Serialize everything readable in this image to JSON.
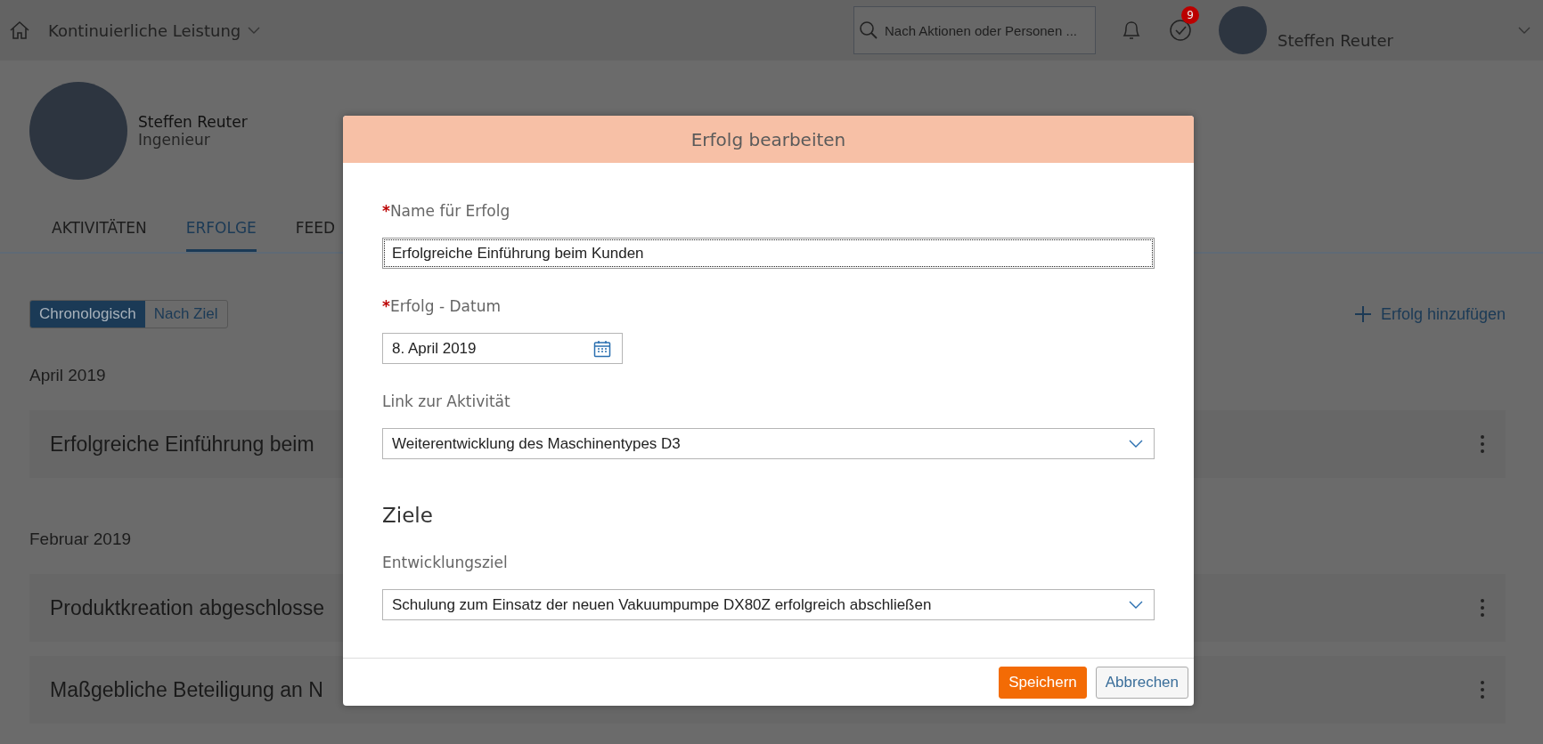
{
  "shell": {
    "title": "Kontinuierliche Leistung",
    "search": {
      "placeholder": "Nach Aktionen oder Personen ..."
    },
    "task_badge": "9",
    "user_name": "Steffen Reuter"
  },
  "profile": {
    "name": "Steffen Reuter",
    "role": "Ingenieur"
  },
  "tabs": [
    {
      "label": "AKTIVITÄTEN",
      "selected": false
    },
    {
      "label": "ERFOLGE",
      "selected": true
    },
    {
      "label": "FEED",
      "selected": false
    }
  ],
  "view_toggle": [
    {
      "label": "Chronologisch",
      "selected": true
    },
    {
      "label": "Nach Ziel",
      "selected": false
    }
  ],
  "add_button": "Erfolg hinzufügen",
  "groups": [
    {
      "month": "April 2019",
      "items": [
        "Erfolgreiche Einführung beim"
      ]
    },
    {
      "month": "Februar 2019",
      "items": [
        "Produktkreation abgeschlosse",
        "Maßgebliche Beteiligung an N"
      ]
    }
  ],
  "dialog": {
    "title": "Erfolg bearbeiten",
    "fields": [
      {
        "kind": "text",
        "label": "Name für Erfolg",
        "required_mark": "*",
        "value": "Erfolgreiche Einführung beim Kunden",
        "focused": true
      },
      {
        "kind": "date",
        "label": "Erfolg - Datum",
        "required_mark": "*",
        "value": "8. April 2019",
        "focused": false
      },
      {
        "kind": "select",
        "label": "Link zur Aktivität",
        "value": "Weiterentwicklung des Maschinentypes D3",
        "focused": false
      }
    ],
    "section": "Ziele",
    "goal_fields": [
      {
        "kind": "select",
        "label": "Entwicklungsziel",
        "value": "Schulung zum Einsatz der neuen Vakuumpumpe DX80Z erfolgreich abschließen",
        "focused": false
      }
    ],
    "buttons": [
      {
        "label": "Speichern",
        "kind": "primary"
      },
      {
        "label": "Abbrechen",
        "kind": "secondary"
      }
    ]
  }
}
